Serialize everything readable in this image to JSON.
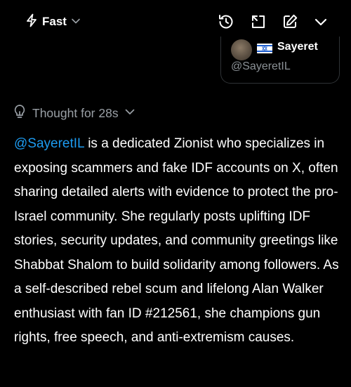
{
  "header": {
    "mode_label": "Fast",
    "mode_icon": "bolt-icon",
    "actions": [
      "history-icon",
      "expand-icon",
      "edit-icon",
      "chevron-down-icon"
    ]
  },
  "user_card": {
    "name": "Sayeret",
    "handle": "@SayeretIL"
  },
  "thought": {
    "label": "Thought for 28s"
  },
  "answer": {
    "mention": "@SayeretIL",
    "text": " is a dedicated Zionist who specializes in exposing scammers and fake IDF accounts on X, often sharing detailed alerts with evidence to protect the pro-Israel community. She regularly posts uplifting IDF stories, security updates, and community greetings like Shabbat Shalom to build solidarity among followers. As a self-described rebel scum and lifelong Alan Walker enthusiast with fan ID #212561, she champions gun rights, free speech, and anti-extremism causes."
  },
  "colors": {
    "background": "#000000",
    "text": "#ffffff",
    "muted": "#9aa0a6",
    "link": "#1d9bf0",
    "border": "#2f3336"
  }
}
